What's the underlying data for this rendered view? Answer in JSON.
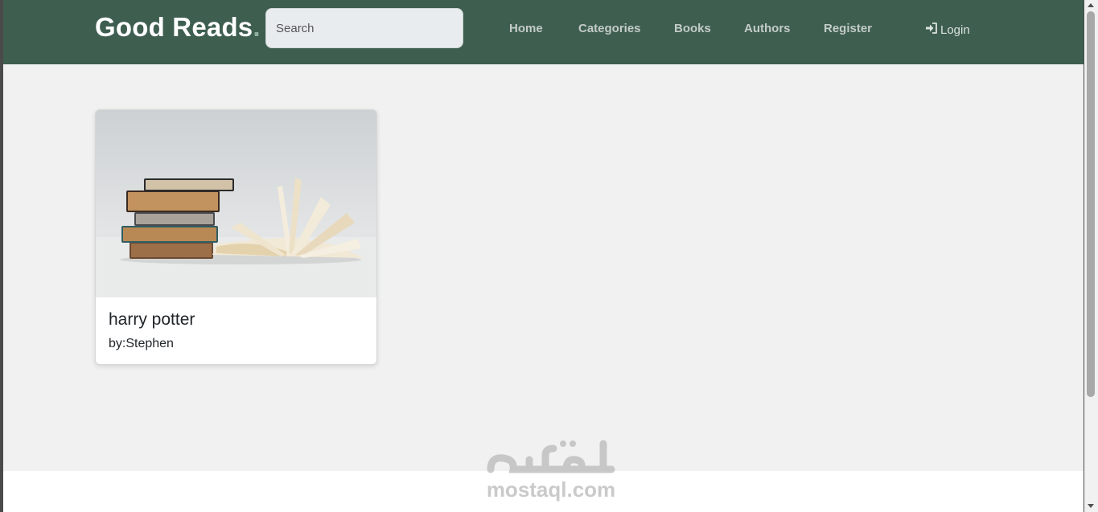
{
  "header": {
    "brand": "Good Reads",
    "brand_dot": ".",
    "search_placeholder": "Search",
    "nav": {
      "home": "Home",
      "categories": "Categories",
      "books": "Books",
      "authors": "Authors",
      "register": "Register",
      "login": "Login"
    },
    "login_icon": "sign-in-icon"
  },
  "books": [
    {
      "title": "harry potter",
      "author": "by:Stephen",
      "image": "stacked-books-open-book-photo"
    }
  ],
  "watermark": {
    "arabic_logo": "مستقل",
    "url": "mostaql.com"
  },
  "colors": {
    "navbar": "#3e5e50",
    "page_bg": "#f0f1f0",
    "nav_text": "#c3ccc7",
    "brand_text": "#ffffff"
  }
}
